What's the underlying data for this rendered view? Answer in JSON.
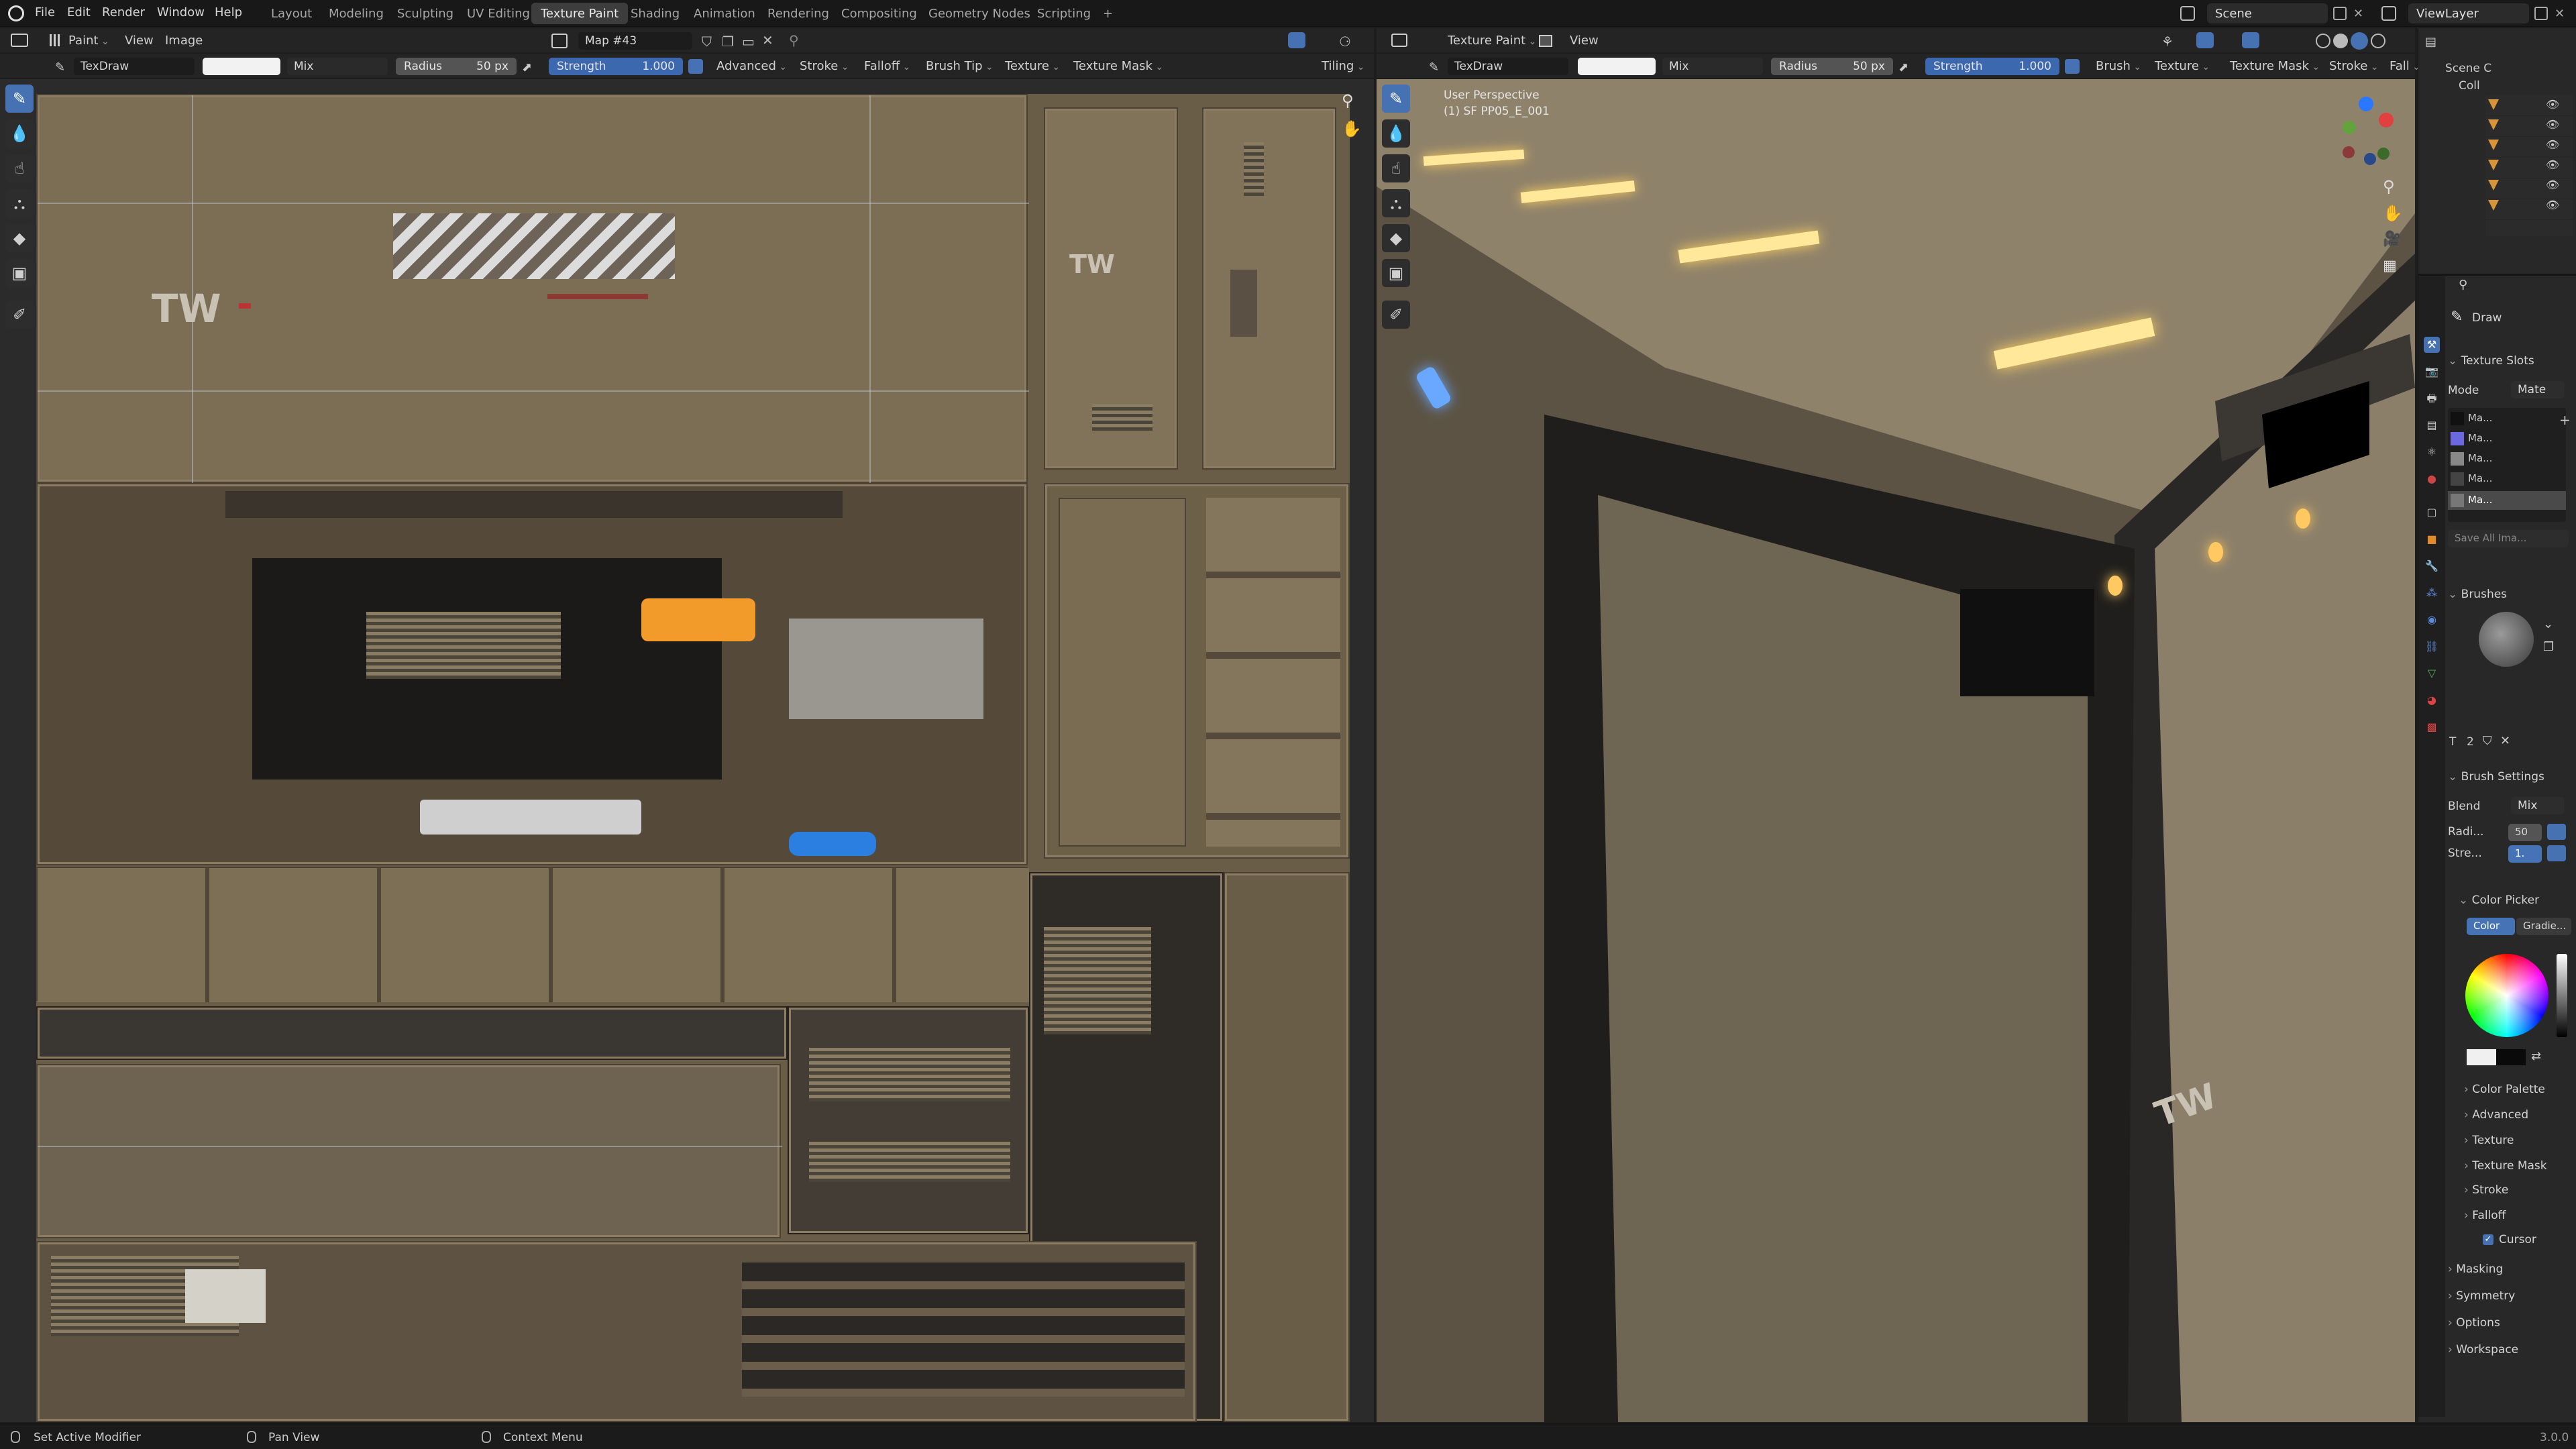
{
  "menubar": {
    "menus": [
      "File",
      "Edit",
      "Render",
      "Window",
      "Help"
    ],
    "workspaces": [
      "Layout",
      "Modeling",
      "Sculpting",
      "UV Editing",
      "Texture Paint",
      "Shading",
      "Animation",
      "Rendering",
      "Compositing",
      "Geometry Nodes",
      "Scripting"
    ],
    "active_workspace": "Texture Paint",
    "add_tab": "+",
    "scene": "Scene",
    "view_layer": "ViewLayer"
  },
  "image_editor": {
    "mode": "Paint",
    "menus": [
      "View",
      "Image"
    ],
    "image_name": "Map #43",
    "tool_settings": {
      "brush": "TexDraw",
      "blend": "Mix",
      "radius_label": "Radius",
      "radius_value": "50 px",
      "strength_label": "Strength",
      "strength_value": "1.000",
      "dropdowns": [
        "Advanced",
        "Stroke",
        "Falloff",
        "Brush Tip",
        "Texture",
        "Texture Mask"
      ],
      "tiling": "Tiling"
    },
    "decals": {
      "logo": "TW",
      "logo_small": "TW"
    }
  },
  "viewport": {
    "editor": "Texture Paint",
    "menus": [
      "View"
    ],
    "perspective": "User Perspective",
    "object": "(1) SF PP05_E_001",
    "tool_settings": {
      "brush": "TexDraw",
      "blend": "Mix",
      "radius_label": "Radius",
      "radius_value": "50 px",
      "strength_label": "Strength",
      "strength_value": "1.000",
      "dropdowns": [
        "Brush",
        "Texture",
        "Texture Mask",
        "Stroke",
        "Fall"
      ]
    },
    "decal": "TW"
  },
  "properties": {
    "outliner_root": "Scene C",
    "outliner_coll": "Coll",
    "tool_name": "Draw",
    "texture_slots": {
      "title": "Texture Slots",
      "mode_label": "Mode",
      "mode_value": "Mate",
      "slots": [
        "Ma...",
        "Ma...",
        "Ma...",
        "Ma...",
        "Ma..."
      ],
      "save_all": "Save All Ima..."
    },
    "brushes": {
      "title": "Brushes",
      "user_count": "2"
    },
    "brush_settings": {
      "title": "Brush Settings",
      "blend_label": "Blend",
      "blend_value": "Mix",
      "radius_label": "Radi...",
      "radius_value": "50",
      "strength_label": "Stre...",
      "strength_value": "1."
    },
    "color_picker": {
      "title": "Color Picker",
      "tabs": [
        "Color",
        "Gradie..."
      ]
    },
    "subpanels": [
      "Color Palette",
      "Advanced",
      "Texture",
      "Texture Mask",
      "Stroke",
      "Falloff",
      "Cursor"
    ],
    "panels": [
      "Masking",
      "Symmetry",
      "Options",
      "Workspace"
    ]
  },
  "statusbar": {
    "items": [
      "Set Active Modifier",
      "Pan View",
      "Context Menu"
    ],
    "version": "3.0.0"
  }
}
